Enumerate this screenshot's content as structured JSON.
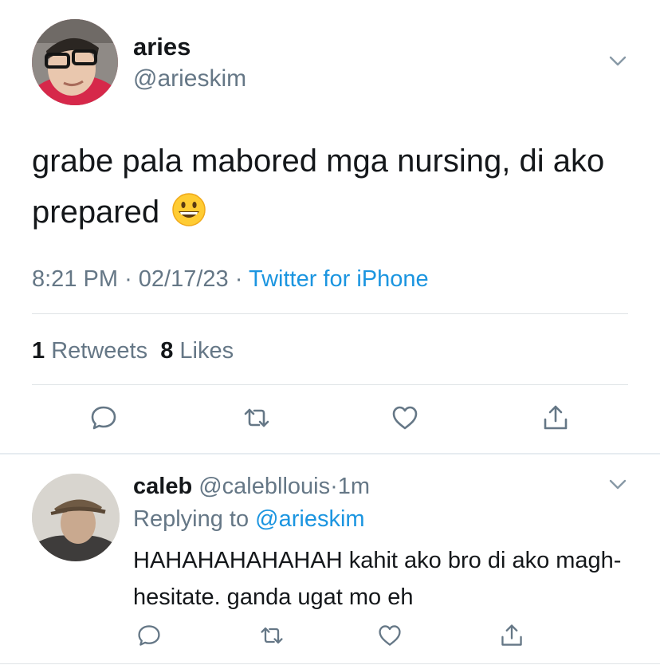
{
  "tweet": {
    "display_name": "aries",
    "handle": "@arieskim",
    "text": "grabe pala mabored mga nursing, di ako prepared",
    "emoji": "grinning-face-emoji",
    "time": "8:21 PM",
    "date": "02/17/23",
    "separator": "·",
    "source": "Twitter for iPhone",
    "retweets_count": "1",
    "retweets_label": "Retweets",
    "likes_count": "8",
    "likes_label": "Likes",
    "actions": [
      "reply-icon",
      "retweet-icon",
      "like-icon",
      "share-icon"
    ]
  },
  "reply": {
    "display_name": "caleb",
    "handle": "@calebllouis",
    "separator": "·",
    "time": "1m",
    "replying_prefix": "Replying to",
    "replying_to": "@arieskim",
    "text": "HAHAHAHAHAHAH kahit ako bro di ako magh-hesitate. ganda ugat mo eh",
    "actions": [
      "reply-icon",
      "retweet-icon",
      "like-icon",
      "share-icon"
    ]
  },
  "colors": {
    "link": "#1b95e0",
    "secondary_text": "#657786",
    "primary_text": "#14171a",
    "divider": "#dfe3e6"
  }
}
